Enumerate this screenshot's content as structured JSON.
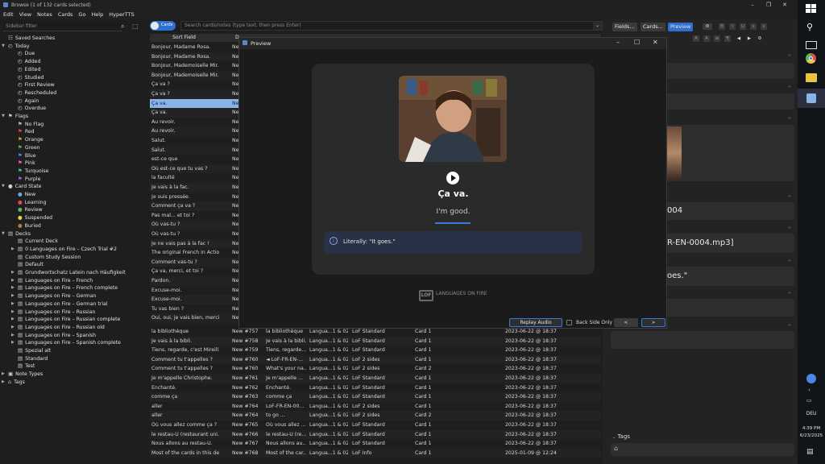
{
  "window": {
    "title": "Browse (1 of 132 cards selected)",
    "menu": [
      "Edit",
      "View",
      "Notes",
      "Cards",
      "Go",
      "Help",
      "HyperTTS"
    ]
  },
  "sidebar": {
    "filter_placeholder": "Sidebar filter",
    "items": [
      {
        "label": "Saved Searches",
        "indent": 0,
        "icon": "saved-search-icon",
        "color": "#cfcfcf"
      },
      {
        "label": "Today",
        "indent": 0,
        "icon": "clock-icon",
        "color": "#cfcfcf",
        "expanded": true
      },
      {
        "label": "Due",
        "indent": 1,
        "icon": "clock-icon",
        "color": "#cfcfcf"
      },
      {
        "label": "Added",
        "indent": 1,
        "icon": "clock-icon",
        "color": "#cfcfcf"
      },
      {
        "label": "Edited",
        "indent": 1,
        "icon": "clock-icon",
        "color": "#cfcfcf"
      },
      {
        "label": "Studied",
        "indent": 1,
        "icon": "clock-icon",
        "color": "#cfcfcf"
      },
      {
        "label": "First Review",
        "indent": 1,
        "icon": "clock-icon",
        "color": "#cfcfcf"
      },
      {
        "label": "Rescheduled",
        "indent": 1,
        "icon": "clock-icon",
        "color": "#cfcfcf"
      },
      {
        "label": "Again",
        "indent": 1,
        "icon": "clock-icon",
        "color": "#cfcfcf"
      },
      {
        "label": "Overdue",
        "indent": 1,
        "icon": "clock-icon",
        "color": "#cfcfcf"
      },
      {
        "label": "Flags",
        "indent": 0,
        "icon": "flag-icon",
        "color": "#cfcfcf",
        "expanded": true
      },
      {
        "label": "No Flag",
        "indent": 1,
        "icon": "flag-icon",
        "color": "#bfbfbf"
      },
      {
        "label": "Red",
        "indent": 1,
        "icon": "flag-icon",
        "color": "#e24c4c"
      },
      {
        "label": "Orange",
        "indent": 1,
        "icon": "flag-icon",
        "color": "#ef9a3c"
      },
      {
        "label": "Green",
        "indent": 1,
        "icon": "flag-icon",
        "color": "#4cbf5a"
      },
      {
        "label": "Blue",
        "indent": 1,
        "icon": "flag-icon",
        "color": "#4a86e8"
      },
      {
        "label": "Pink",
        "indent": 1,
        "icon": "flag-icon",
        "color": "#e86ac8"
      },
      {
        "label": "Turquoise",
        "indent": 1,
        "icon": "flag-icon",
        "color": "#3cc8c0"
      },
      {
        "label": "Purple",
        "indent": 1,
        "icon": "flag-icon",
        "color": "#9a6ae8"
      },
      {
        "label": "Card State",
        "indent": 0,
        "icon": "circle-icon",
        "color": "#cfcfcf",
        "expanded": true
      },
      {
        "label": "New",
        "indent": 1,
        "icon": "circle-icon",
        "color": "#6aa8f0"
      },
      {
        "label": "Learning",
        "indent": 1,
        "icon": "circle-icon",
        "color": "#e24c4c"
      },
      {
        "label": "Review",
        "indent": 1,
        "icon": "circle-icon",
        "color": "#4cbf5a"
      },
      {
        "label": "Suspended",
        "indent": 1,
        "icon": "circle-icon",
        "color": "#e8d84c"
      },
      {
        "label": "Buried",
        "indent": 1,
        "icon": "circle-icon",
        "color": "#b07a4a"
      },
      {
        "label": "Decks",
        "indent": 0,
        "icon": "deck-icon",
        "color": "#cfcfcf",
        "expanded": true
      },
      {
        "label": "Current Deck",
        "indent": 1,
        "icon": "deck-icon",
        "color": "#cfcfcf"
      },
      {
        "label": "0 Languages on Fire – Czech Trial #2",
        "indent": 1,
        "icon": "deck-icon",
        "color": "#cfcfcf",
        "collapsed": true
      },
      {
        "label": "Custom Study Session",
        "indent": 1,
        "icon": "deck-icon",
        "color": "#cfcfcf"
      },
      {
        "label": "Default",
        "indent": 1,
        "icon": "deck-icon",
        "color": "#cfcfcf"
      },
      {
        "label": "Grundwortschatz Latein nach Häufigkeit",
        "indent": 1,
        "icon": "deck-icon",
        "color": "#cfcfcf",
        "collapsed": true
      },
      {
        "label": "Languages on Fire – French",
        "indent": 1,
        "icon": "deck-icon",
        "color": "#cfcfcf",
        "collapsed": true
      },
      {
        "label": "Languages on Fire – French complete",
        "indent": 1,
        "icon": "deck-icon",
        "color": "#cfcfcf",
        "collapsed": true
      },
      {
        "label": "Languages on Fire – German",
        "indent": 1,
        "icon": "deck-icon",
        "color": "#cfcfcf",
        "collapsed": true
      },
      {
        "label": "Languages on Fire – German trial",
        "indent": 1,
        "icon": "deck-icon",
        "color": "#cfcfcf",
        "collapsed": true
      },
      {
        "label": "Languages on Fire – Russian",
        "indent": 1,
        "icon": "deck-icon",
        "color": "#cfcfcf",
        "collapsed": true
      },
      {
        "label": "Languages on Fire – Russian complete",
        "indent": 1,
        "icon": "deck-icon",
        "color": "#cfcfcf",
        "collapsed": true
      },
      {
        "label": "Languages on Fire – Russian old",
        "indent": 1,
        "icon": "deck-icon",
        "color": "#cfcfcf",
        "collapsed": true
      },
      {
        "label": "Languages on Fire – Spanish",
        "indent": 1,
        "icon": "deck-icon",
        "color": "#cfcfcf",
        "collapsed": true
      },
      {
        "label": "Languages on Fire – Spanish complete",
        "indent": 1,
        "icon": "deck-icon",
        "color": "#cfcfcf",
        "collapsed": true
      },
      {
        "label": "Spezial alt",
        "indent": 1,
        "icon": "deck-icon",
        "color": "#cfcfcf"
      },
      {
        "label": "Standard",
        "indent": 1,
        "icon": "deck-icon",
        "color": "#cfcfcf"
      },
      {
        "label": "Test",
        "indent": 1,
        "icon": "deck-icon",
        "color": "#cfcfcf"
      },
      {
        "label": "Note Types",
        "indent": 0,
        "icon": "note-type-icon",
        "color": "#cfcfcf",
        "collapsed": true
      },
      {
        "label": "Tags",
        "indent": 0,
        "icon": "tag-icon",
        "color": "#cfcfcf",
        "collapsed": true
      }
    ]
  },
  "search": {
    "toggle_label": "Cards",
    "placeholder": "Search cards/notes (type text, then press Enter)"
  },
  "table": {
    "columns": [
      "Sort Field",
      "D"
    ],
    "rows_top": [
      {
        "sort": "Bonjour, Madame Rosa.",
        "due": "Ne"
      },
      {
        "sort": "Bonjour, Madame Rosa.",
        "due": "Ne"
      },
      {
        "sort": "Bonjour, Mademoiselle Mir...",
        "due": "Ne"
      },
      {
        "sort": "Bonjour, Mademoiselle Mir...",
        "due": "Ne"
      },
      {
        "sort": "Ça va ?",
        "due": "Ne"
      },
      {
        "sort": "Ça va ?",
        "due": "Ne"
      },
      {
        "sort": "Ça va.",
        "due": "Ne",
        "selected": true
      },
      {
        "sort": "Ça va.",
        "due": "Ne"
      },
      {
        "sort": "Au revoir.",
        "due": "Ne"
      },
      {
        "sort": "Au revoir.",
        "due": "Ne"
      },
      {
        "sort": "Salut.",
        "due": "Ne"
      },
      {
        "sort": "Salut.",
        "due": "Ne"
      },
      {
        "sort": "est-ce que",
        "due": "Ne"
      },
      {
        "sort": "Où est-ce que tu vas ?",
        "due": "Ne"
      },
      {
        "sort": "la faculté",
        "due": "Ne"
      },
      {
        "sort": "Je vais à la fac.",
        "due": "Ne"
      },
      {
        "sort": "Je suis pressée.",
        "due": "Ne"
      },
      {
        "sort": "Comment ça va ?",
        "due": "Ne"
      },
      {
        "sort": "Pas mal... et toi ?",
        "due": "Ne"
      },
      {
        "sort": "Où vas-tu ?",
        "due": "Ne"
      },
      {
        "sort": "Où vas-tu ?",
        "due": "Ne"
      },
      {
        "sort": "Je ne vais pas à la fac !",
        "due": "Ne"
      },
      {
        "sort": "The original French in Actio...",
        "due": "Ne"
      },
      {
        "sort": "Comment vas-tu ?",
        "due": "Ne"
      },
      {
        "sort": "Ça va, merci, et toi ?",
        "due": "Ne"
      },
      {
        "sort": "Pardon.",
        "due": "Ne"
      },
      {
        "sort": "Excuse-moi.",
        "due": "Ne"
      },
      {
        "sort": "Excuse-moi.",
        "due": "Ne"
      },
      {
        "sort": "Tu vas bien ?",
        "due": "Ne"
      },
      {
        "sort": "Oui, oui, je vais bien, merci.",
        "due": "Ne"
      }
    ],
    "rows_bottom": [
      {
        "sort": "la bibliothèque",
        "due": "New #757",
        "q": "la bibliothèque",
        "deck": "Langua...1 & 02",
        "type": "LoF Standard",
        "card": "Card 1",
        "date": "2023-06-22 @ 18:37"
      },
      {
        "sort": "Je vais à la bibli.",
        "due": "New #758",
        "q": "Je vais à la bibli.",
        "deck": "Langua...1 & 02",
        "type": "LoF Standard",
        "card": "Card 1",
        "date": "2023-06-22 @ 18:37"
      },
      {
        "sort": "Tiens, regarde, c'est Mireill...",
        "due": "New #759",
        "q": "Tiens, regarde...",
        "deck": "Langua...1 & 02",
        "type": "LoF Standard",
        "card": "Card 1",
        "date": "2023-06-22 @ 18:37"
      },
      {
        "sort": "Comment tu t'appelles ?",
        "due": "New #760",
        "q": "◄ LoF-FR-EN-...",
        "deck": "Langua...1 & 02",
        "type": "LoF 2 sides",
        "card": "Card 1",
        "date": "2023-06-22 @ 18:37"
      },
      {
        "sort": "Comment tu t'appelles ?",
        "due": "New #760",
        "q": "What's your na...",
        "deck": "Langua...1 & 02",
        "type": "LoF 2 sides",
        "card": "Card 2",
        "date": "2023-06-22 @ 18:37"
      },
      {
        "sort": "Je m'appelle Christophe.",
        "due": "New #761",
        "q": "Je m'appelle ...",
        "deck": "Langua...1 & 02",
        "type": "LoF Standard",
        "card": "Card 1",
        "date": "2023-06-22 @ 18:37"
      },
      {
        "sort": "Enchanté.",
        "due": "New #762",
        "q": "Enchanté.",
        "deck": "Langua...1 & 02",
        "type": "LoF Standard",
        "card": "Card 1",
        "date": "2023-06-22 @ 18:37"
      },
      {
        "sort": "comme ça",
        "due": "New #763",
        "q": "comme ça",
        "deck": "Langua...1 & 02",
        "type": "LoF Standard",
        "card": "Card 1",
        "date": "2023-06-22 @ 18:37"
      },
      {
        "sort": "aller",
        "due": "New #764",
        "q": "LoF-FR-EN-00...",
        "deck": "Langua...1 & 02",
        "type": "LoF 2 sides",
        "card": "Card 1",
        "date": "2023-06-22 @ 18:37"
      },
      {
        "sort": "aller",
        "due": "New #764",
        "q": "to go ...",
        "deck": "Langua...1 & 02",
        "type": "LoF 2 sides",
        "card": "Card 2",
        "date": "2023-06-22 @ 18:37"
      },
      {
        "sort": "Où vous allez comme ça ?",
        "due": "New #765",
        "q": "Où vous allez ...",
        "deck": "Langua...1 & 02",
        "type": "LoF Standard",
        "card": "Card 1",
        "date": "2023-06-22 @ 18:37"
      },
      {
        "sort": "le restau-U (restaurant uni...",
        "due": "New #766",
        "q": "le restau-U (re...",
        "deck": "Langua...1 & 02",
        "type": "LoF Standard",
        "card": "Card 1",
        "date": "2023-06-22 @ 18:37"
      },
      {
        "sort": "Nous allons au restau-U.",
        "due": "New #767",
        "q": "Nous allons au...",
        "deck": "Langua...1 & 02",
        "type": "LoF Standard",
        "card": "Card 1",
        "date": "2023-06-22 @ 18:37"
      },
      {
        "sort": "Most of the cards in this de...",
        "due": "New #768",
        "q": "Most of the car...",
        "deck": "Langua...1 & 02",
        "type": "LoF Info",
        "card": "Card 1",
        "date": "2025-01-09 @ 12:24"
      }
    ]
  },
  "editor": {
    "fields_button": "Fields...",
    "cards_button": "Cards...",
    "preview_button": "Preview",
    "field_texts": [
      "004",
      "R-EN-0004.mp3]",
      "oes.\""
    ],
    "tags_label": "Tags"
  },
  "preview": {
    "title": "Preview",
    "front": "Ça va.",
    "back": "I'm good.",
    "note_text": "Literally: \"It goes.\"",
    "logo_text": "LANGUAGES ON FIRE",
    "logo_mark": "LOF",
    "replay_button": "Replay Audio",
    "back_only_label": "Back Side Only",
    "prev_button": "<",
    "next_button": ">"
  },
  "taskbar": {
    "lang": "DEU",
    "time": "4:39 PM",
    "date": "6/23/2025"
  },
  "colors": {
    "accent": "#2f6fcf",
    "selected_row": "#8ab4e8",
    "background": "#1e1e1e"
  }
}
